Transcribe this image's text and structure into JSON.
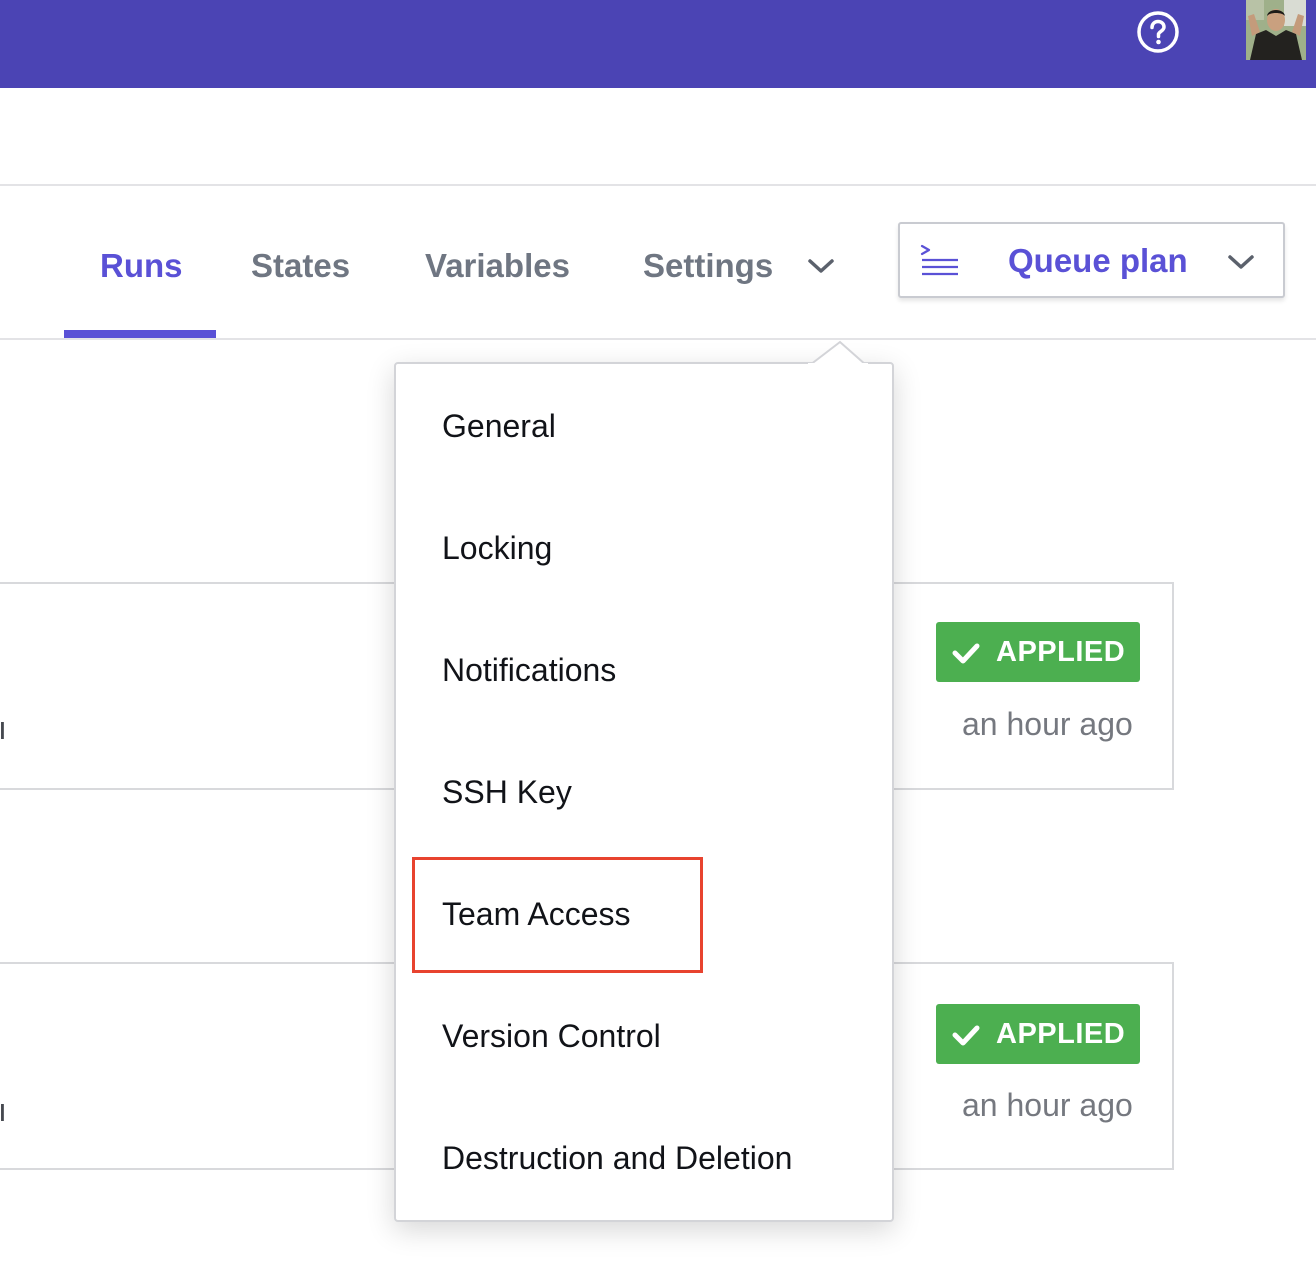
{
  "header": {
    "help_icon": "question-circle-icon",
    "avatar": "user-avatar",
    "bar_color": "#4b44b4"
  },
  "tabs": [
    {
      "label": "Runs",
      "active": true
    },
    {
      "label": "States",
      "active": false
    },
    {
      "label": "Variables",
      "active": false
    },
    {
      "label": "Settings",
      "active": false,
      "icon": "chevron-down-icon"
    }
  ],
  "queue_plan": {
    "label": "Queue plan",
    "icon": "terminal-lines-icon",
    "dropdown_icon": "chevron-down-icon"
  },
  "runs": [
    {
      "status": "APPLIED",
      "time": "an hour ago",
      "status_color": "#4caf50"
    },
    {
      "status": "APPLIED",
      "time": "an hour ago",
      "status_color": "#4caf50"
    }
  ],
  "settings_menu": {
    "items": [
      "General",
      "Locking",
      "Notifications",
      "SSH Key",
      "Team Access",
      "Version Control",
      "Destruction and Deletion"
    ],
    "highlighted": "Team Access",
    "highlight_color": "#e8432f"
  },
  "accent_color": "#5a51d6"
}
